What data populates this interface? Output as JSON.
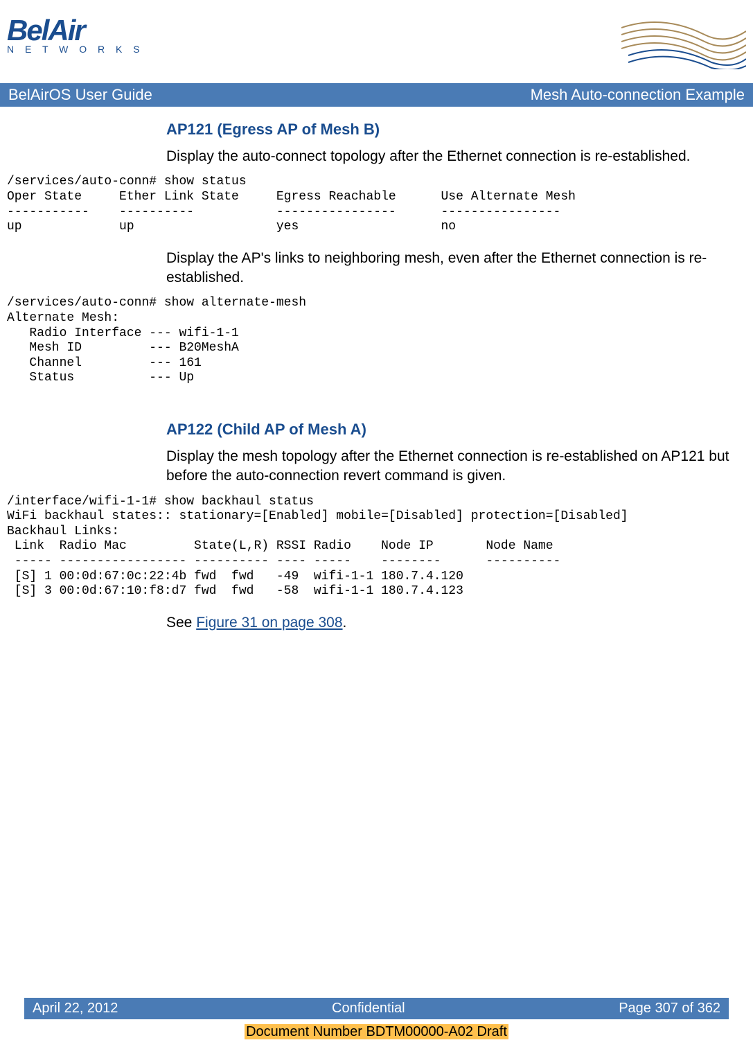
{
  "logo": {
    "top": "BelAir",
    "bottom": "N E T W O R K S"
  },
  "header": {
    "left": "BelAirOS User Guide",
    "right": "Mesh Auto-connection Example"
  },
  "section1": {
    "heading": "AP121 (Egress AP of Mesh B)",
    "para1": "Display the auto-connect topology after the Ethernet connection is re-established.",
    "code1": "/services/auto-conn# show status\nOper State     Ether Link State     Egress Reachable      Use Alternate Mesh\n-----------    ----------           ----------------      ----------------\nup             up                   yes                   no",
    "para2": "Display the AP's links to neighboring mesh, even after the Ethernet connection is re-established.",
    "code2": "/services/auto-conn# show alternate-mesh\nAlternate Mesh:\n   Radio Interface --- wifi-1-1\n   Mesh ID         --- B20MeshA\n   Channel         --- 161\n   Status          --- Up"
  },
  "section2": {
    "heading": "AP122 (Child AP of Mesh A)",
    "para1": "Display the mesh topology after the Ethernet connection is re-established on AP121 but before the auto-connection revert command is given.",
    "code1": "/interface/wifi-1-1# show backhaul status\nWiFi backhaul states:: stationary=[Enabled] mobile=[Disabled] protection=[Disabled]\nBackhaul Links:\n Link  Radio Mac         State(L,R) RSSI Radio    Node IP       Node Name\n ----- ----------------- ---------- ---- -----    --------      ----------\n [S] 1 00:0d:67:0c:22:4b fwd  fwd   -49  wifi-1-1 180.7.4.120\n [S] 3 00:0d:67:10:f8:d7 fwd  fwd   -58  wifi-1-1 180.7.4.123",
    "seePrefix": "See ",
    "seeLink": "Figure 31 on page 308",
    "seeSuffix": "."
  },
  "footer": {
    "left": "April 22, 2012",
    "center": "Confidential",
    "right": "Page 307 of 362"
  },
  "docnum": "Document Number BDTM00000-A02 Draft"
}
